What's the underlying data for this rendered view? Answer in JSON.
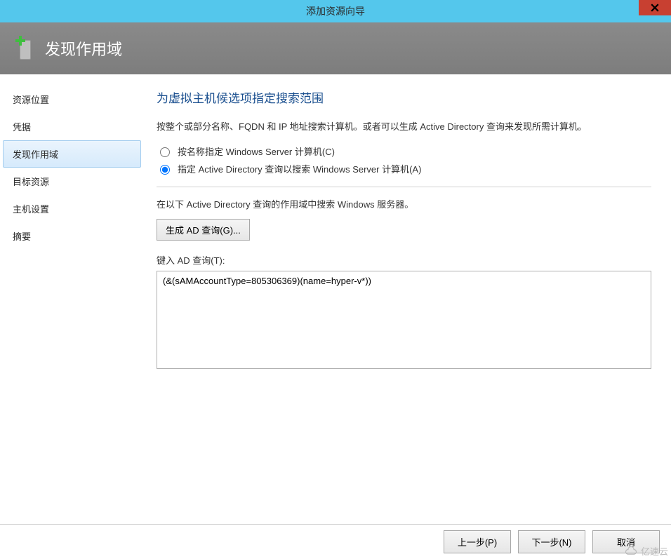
{
  "window": {
    "title": "添加资源向导"
  },
  "header": {
    "title": "发现作用域"
  },
  "sidebar": {
    "items": [
      {
        "label": "资源位置",
        "selected": false
      },
      {
        "label": "凭据",
        "selected": false
      },
      {
        "label": "发现作用域",
        "selected": true
      },
      {
        "label": "目标资源",
        "selected": false
      },
      {
        "label": "主机设置",
        "selected": false
      },
      {
        "label": "摘要",
        "selected": false
      }
    ]
  },
  "content": {
    "title": "为虚拟主机候选项指定搜索范围",
    "description": "按整个或部分名称、FQDN 和 IP 地址搜索计算机。或者可以生成 Active Directory 查询来发现所需计算机。",
    "radio1": {
      "label": "按名称指定 Windows Server 计算机(C)",
      "checked": false
    },
    "radio2": {
      "label": "指定 Active Directory 查询以搜索 Windows Server 计算机(A)",
      "checked": true
    },
    "instruction": "在以下 Active Directory 查询的作用域中搜索 Windows 服务器。",
    "generate_btn": "生成 AD 查询(G)...",
    "query_label": "键入 AD 查询(T):",
    "query_value": "(&(sAMAccountType=805306369)(name=hyper-v*))"
  },
  "footer": {
    "prev": "上一步(P)",
    "next": "下一步(N)",
    "cancel": "取消"
  },
  "watermark": "亿速云"
}
